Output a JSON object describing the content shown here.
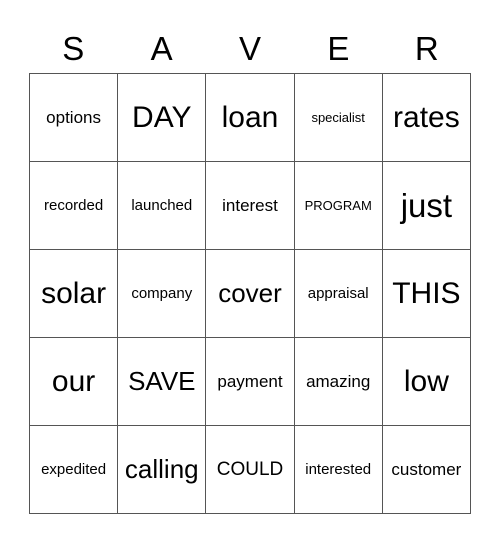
{
  "header": [
    "S",
    "A",
    "V",
    "E",
    "R"
  ],
  "cells": [
    [
      "options",
      "DAY",
      "loan",
      "specialist",
      "rates"
    ],
    [
      "recorded",
      "launched",
      "interest",
      "PROGRAM",
      "just"
    ],
    [
      "solar",
      "company",
      "cover",
      "appraisal",
      "THIS"
    ],
    [
      "our",
      "SAVE",
      "payment",
      "amazing",
      "low"
    ],
    [
      "expedited",
      "calling",
      "COULD",
      "interested",
      "customer"
    ]
  ]
}
